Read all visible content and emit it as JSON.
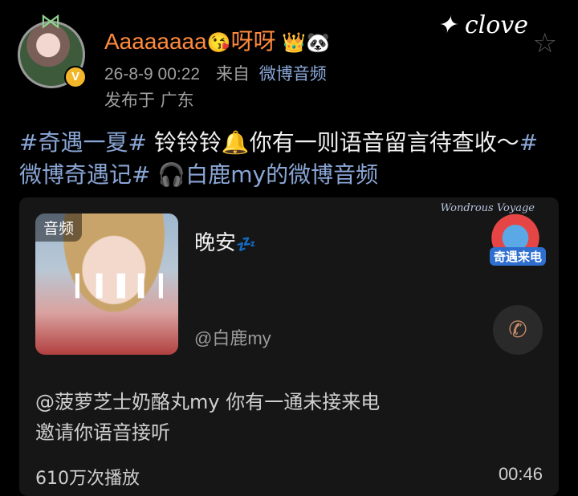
{
  "user": {
    "name": "Aaaaaaaa",
    "name_emoji": "😘",
    "name_suffix": "呀呀",
    "badge_emojis": "👑🐼",
    "verified_symbol": "V"
  },
  "meta": {
    "timestamp": "26-8-9 00:22",
    "source_prefix": "来自",
    "source_app": "微博音频",
    "location": "发布于 广东"
  },
  "decor": {
    "love_text": "✦ clove"
  },
  "post": {
    "tag1": "#奇遇一夏#",
    "text1": " 铃铃铃🔔你有一则语音留言待查收～",
    "tag2": "#微博奇遇记#",
    "link": " 🎧白鹿my的微博音频"
  },
  "card": {
    "banner_text": "Wondrous Voyage",
    "cover_label": "音频",
    "title": "晚安",
    "title_emoji": "💤",
    "author": "@白鹿my",
    "brand_text": "奇遇来电",
    "call_icon": "phone-icon",
    "description_line1": "@菠萝芝士奶酪丸my 你有一通未接来电",
    "description_line2": "邀请你语音接听",
    "plays": "610万次播放",
    "duration": "00:46"
  },
  "colors": {
    "username": "#ff8a3d",
    "link": "#8aa6d6",
    "background": "#000000",
    "card_bg": "#161616"
  }
}
